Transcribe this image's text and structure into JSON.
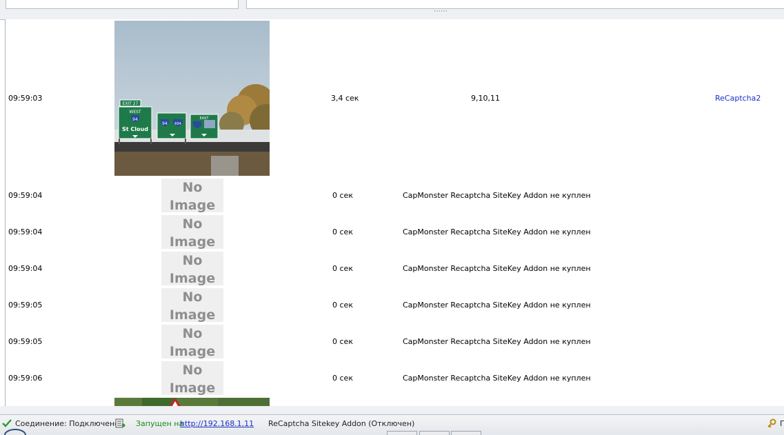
{
  "status": {
    "connection_label": "Соединение: Подключено",
    "running_label": "Запущен на",
    "running_url": "http://192.168.1.11",
    "addon_label": "ReCaptcha Sitekey Addon (Отключен)",
    "right_clip": "П"
  },
  "no_image": {
    "line1": "No",
    "line2": "Image"
  },
  "log_rows": [
    {
      "time": "09:59:03",
      "speed": "3,4 сек",
      "answer": "9,10,11",
      "type": "ReCaptcha2",
      "image": "captcha-highway-signs"
    },
    {
      "time": "09:59:04",
      "speed": "0 сек",
      "answer": "CapMonster Recaptcha SiteKey Addon не куплен",
      "type": "",
      "image": "no-image"
    },
    {
      "time": "09:59:04",
      "speed": "0 сек",
      "answer": "CapMonster Recaptcha SiteKey Addon не куплен",
      "type": "",
      "image": "no-image"
    },
    {
      "time": "09:59:04",
      "speed": "0 сек",
      "answer": "CapMonster Recaptcha SiteKey Addon не куплен",
      "type": "",
      "image": "no-image"
    },
    {
      "time": "09:59:05",
      "speed": "0 сек",
      "answer": "CapMonster Recaptcha SiteKey Addon не куплен",
      "type": "",
      "image": "no-image"
    },
    {
      "time": "09:59:05",
      "speed": "0 сек",
      "answer": "CapMonster Recaptcha SiteKey Addon не куплен",
      "type": "",
      "image": "no-image"
    },
    {
      "time": "09:59:06",
      "speed": "0 сек",
      "answer": "CapMonster Recaptcha SiteKey Addon не куплен",
      "type": "",
      "image": "no-image"
    }
  ],
  "captcha_signs": {
    "exit": "EXIT 27",
    "west": "WEST",
    "route_94": "94",
    "route_694": "694",
    "east": "EAST",
    "city": "St Cloud"
  },
  "colors": {
    "link": "#1a2fc8",
    "ok": "#1a8a1a",
    "sign_green": "#1f7a4a"
  }
}
